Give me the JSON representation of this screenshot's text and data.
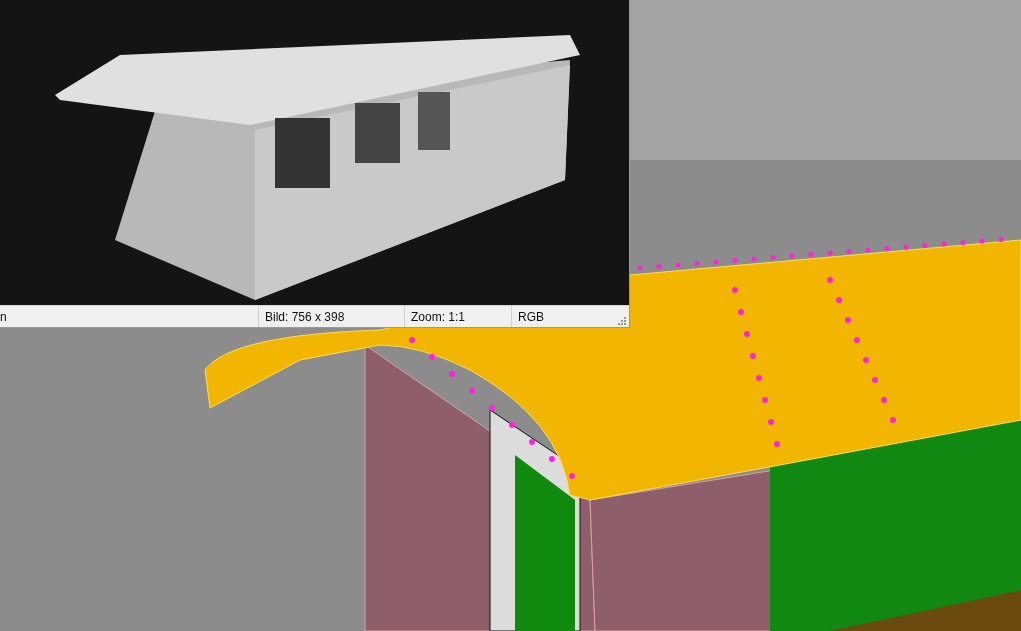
{
  "render_window": {
    "status_bar": [
      "n",
      "Bild: 756 x 398",
      "Zoom: 1:1",
      "RGB"
    ]
  }
}
